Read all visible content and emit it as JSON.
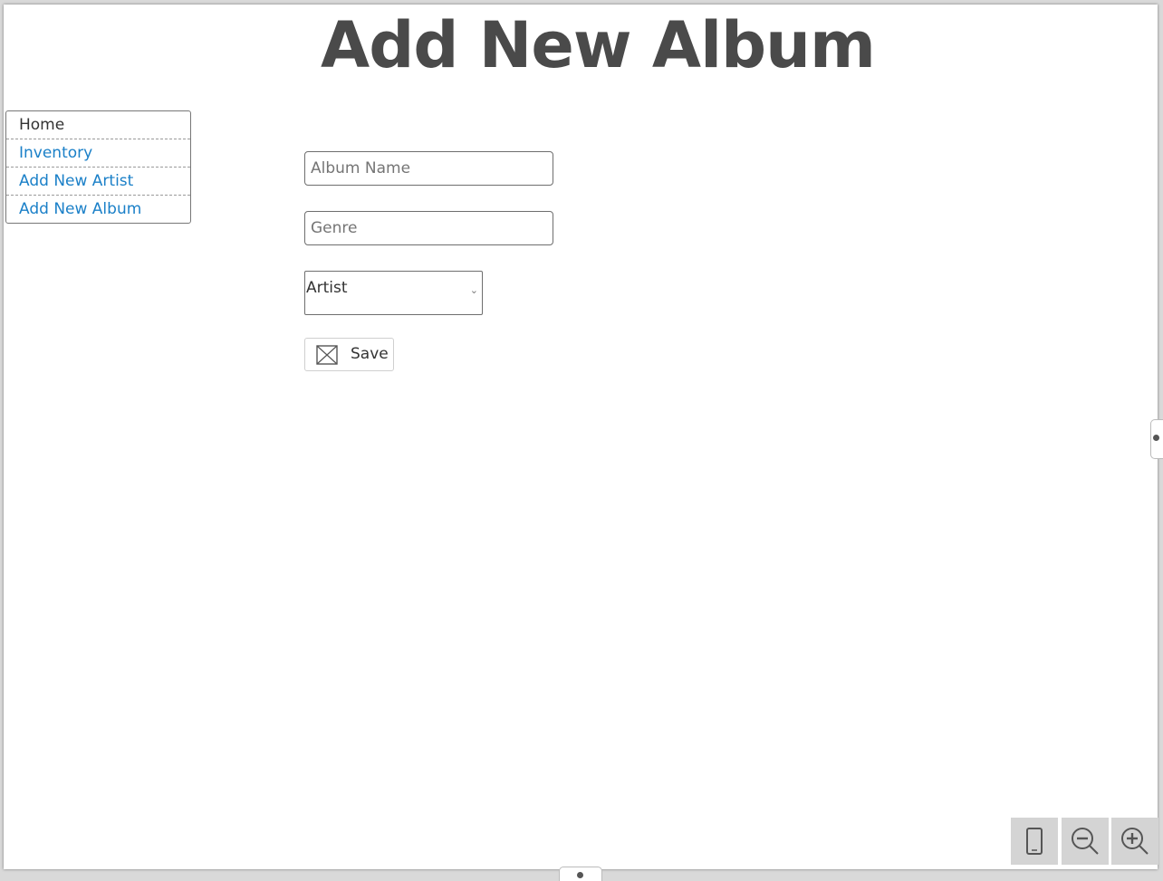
{
  "page": {
    "title": "Add New Album"
  },
  "nav": {
    "items": [
      {
        "label": "Home",
        "current": true
      },
      {
        "label": "Inventory",
        "current": false
      },
      {
        "label": "Add New Artist",
        "current": false
      },
      {
        "label": "Add New Album",
        "current": false
      }
    ]
  },
  "form": {
    "album_name_placeholder": "Album Name",
    "genre_placeholder": "Genre",
    "artist_selected": "Artist",
    "save_label": "Save"
  },
  "colors": {
    "link": "#1b80c8",
    "title": "#4a4a4a"
  },
  "icons": {
    "save": "image-placeholder-icon",
    "fit": "device-fit-icon",
    "zoom_out": "zoom-out-icon",
    "zoom_in": "zoom-in-icon"
  }
}
